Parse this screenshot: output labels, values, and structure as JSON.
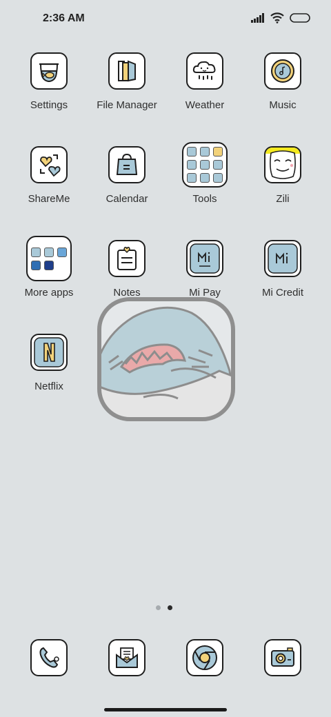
{
  "status": {
    "time": "2:36 AM"
  },
  "apps": [
    {
      "label": "Settings"
    },
    {
      "label": "File Manager"
    },
    {
      "label": "Weather"
    },
    {
      "label": "Music"
    },
    {
      "label": "ShareMe"
    },
    {
      "label": "Calendar"
    },
    {
      "label": "Tools"
    },
    {
      "label": "Zili"
    },
    {
      "label": "More apps"
    },
    {
      "label": "Notes"
    },
    {
      "label": "Mi Pay"
    },
    {
      "label": "Mi Credit"
    },
    {
      "label": "Netflix"
    }
  ],
  "pager": {
    "pages": 2,
    "current": 2
  },
  "colors": {
    "background": "#dde1e3",
    "icon_accent_blue": "#a9c9d8",
    "icon_accent_yellow": "#f2d27a"
  }
}
